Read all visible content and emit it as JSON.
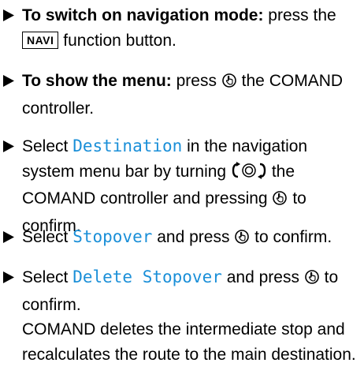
{
  "steps": [
    {
      "lead": "To switch on navigation mode:",
      "text1": "press the",
      "key": "NAVI",
      "text2": "function button."
    },
    {
      "lead": "To show the menu:",
      "text1": "press",
      "text2": "the COMAND controller."
    },
    {
      "text1": "Select",
      "term": "Destination",
      "text2": "in the navigation system menu bar by turning",
      "text3": "the COMAND controller and pressing",
      "text4": "to confirm."
    },
    {
      "text1": "Select",
      "term": "Stopover",
      "text2": "and press",
      "text3": "to confirm."
    },
    {
      "text1": "Select",
      "term": "Delete Stopover",
      "text2": "and press",
      "text3": "to confirm.",
      "result": "COMAND deletes the intermediate stop and recalculates the route to the main destination."
    }
  ],
  "colors": {
    "term": "#1a8fd8",
    "text": "#000000"
  },
  "icons": [
    "step-arrow-icon",
    "press-controller-icon",
    "turn-controller-icon"
  ]
}
